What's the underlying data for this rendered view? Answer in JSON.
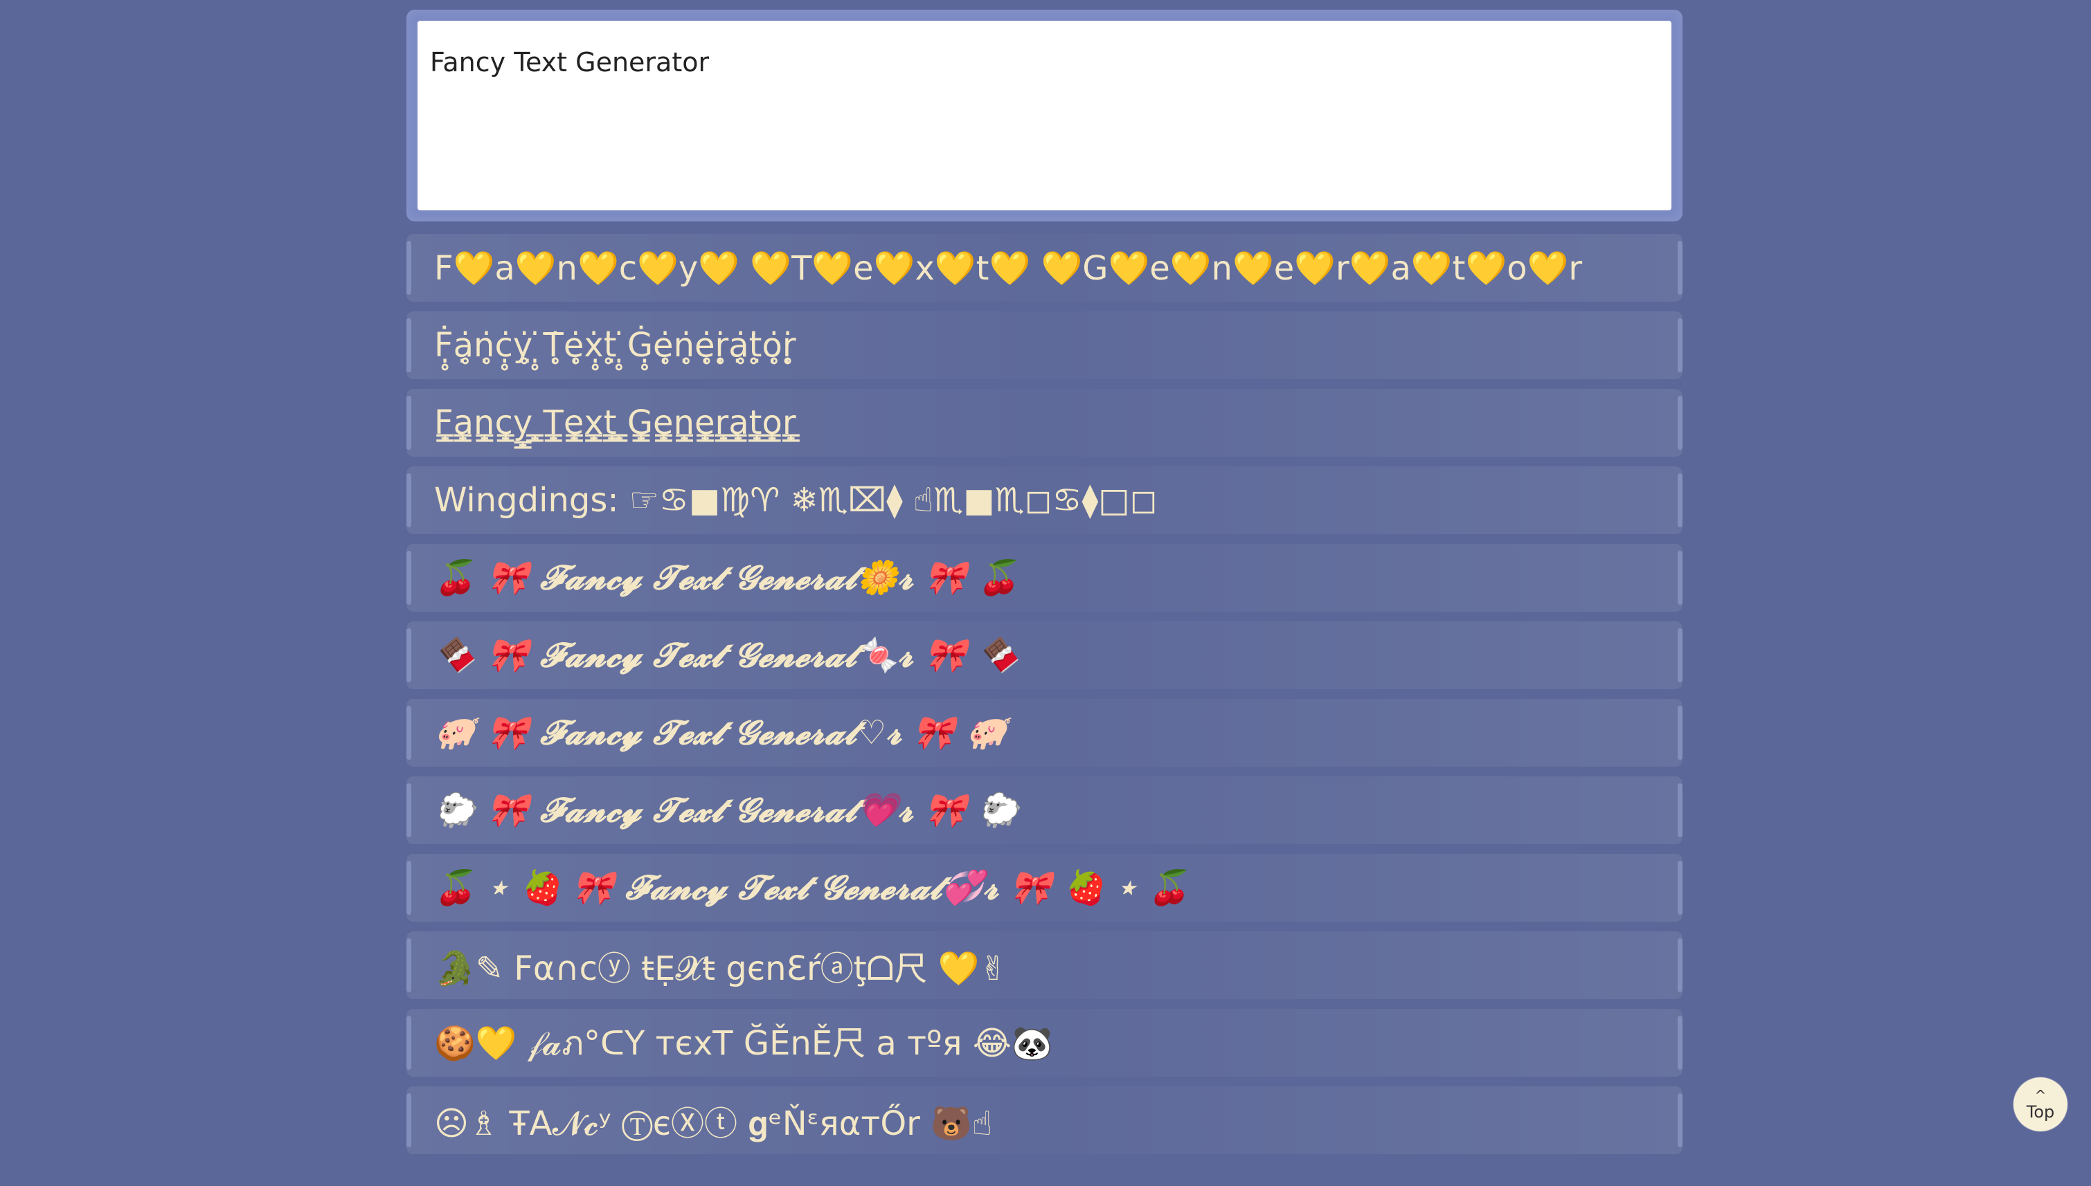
{
  "input": {
    "value": "Fancy Text Generator"
  },
  "results": [
    "F💛a💛n💛c💛y💛 💛T💛e💛x💛t💛 💛G💛e💛n💛e💛r💛a💛t💛o💛r",
    "Ḟ̣̥ạ̥̇ṇ̥̇ċ̣̥ỵ̥̇ ̣̥̇Ṭ̥̇ẹ̥̇ẋ̣̥ṭ̥̇ ̣̥̇Ġ̣̥ẹ̥̇ṇ̥̇ẹ̥̇ṛ̥̇ạ̥̇ṭ̥̇ọ̥̇ṛ̥̇",
    "F̳̟a̳̟n̳̟c̳̟y̳̟ ̳̟T̳̟e̳̟x̳̟t̳̟ ̳̟G̳̟e̳̟n̳̟e̳̟r̳̟a̳̟t̳̟o̳̟r̳̟",
    "Wingdings: ☞♋■♍♈ ❄♏⌧⧫ ☝♏■♏◻♋⧫□◻",
    "🍒 🎀 𝓕𝓪𝓷𝓬𝔂 𝓣𝓮𝔁𝓽 𝓖𝓮𝓷𝓮𝓻𝓪𝓽🌼𝓻 🎀 🍒",
    "🍫 🎀 𝓕𝓪𝓷𝓬𝔂 𝓣𝓮𝔁𝓽 𝓖𝓮𝓷𝓮𝓻𝓪𝓽🍬𝓻 🎀 🍫",
    "🐖 🎀 𝓕𝓪𝓷𝓬𝔂 𝓣𝓮𝔁𝓽 𝓖𝓮𝓷𝓮𝓻𝓪𝓽♡𝓻 🎀 🐖",
    "🐑 🎀 𝓕𝓪𝓷𝓬𝔂 𝓣𝓮𝔁𝓽 𝓖𝓮𝓷𝓮𝓻𝓪𝓽💗𝓻 🎀 🐑",
    "🍒 ⋆ 🍓 🎀 𝓕𝓪𝓷𝓬𝔂 𝓣𝓮𝔁𝓽 𝓖𝓮𝓷𝓮𝓻𝓪𝓽💞𝓻 🎀 🍓 ⋆ 🍒",
    "🐊✎ Fα∩cⓨ ŧẸ𝓧ŧ gєnƐŕⓐţᗝ尺 💛✌",
    "🍪💛 𝒻𝓪ภ°ᑕY тєxT ĞĚnĚ尺 a тºя 😂🐼",
    "☹♗ ŦA𝓝𝓬ʸ ⓉєⓍⓣ 𝐠ᵉŇᵋяαтŐr 🐻☝"
  ],
  "top_button": {
    "chevron": "^",
    "label": "Top"
  }
}
